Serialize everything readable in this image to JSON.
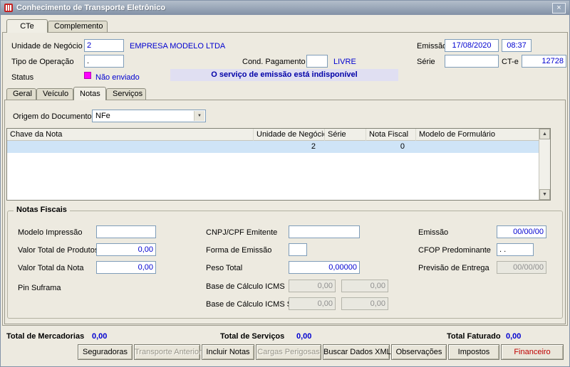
{
  "window": {
    "title": "Conhecimento de Transporte Eletrônico"
  },
  "icons": {
    "close": "×",
    "dropdown_arrow": "▼",
    "scroll_up": "▲",
    "scroll_down": "▼"
  },
  "main_tabs": {
    "cte": "CTe",
    "complemento": "Complemento"
  },
  "header": {
    "unidade_negocio": {
      "label": "Unidade de Negócio",
      "value": "2",
      "empresa": "EMPRESA MODELO LTDA"
    },
    "emissao": {
      "label": "Emissão",
      "date": "17/08/2020",
      "time": "08:37"
    },
    "tipo_operacao": {
      "label": "Tipo de Operação",
      "value": "."
    },
    "cond_pagamento": {
      "label": "Cond. Pagamento",
      "value": "",
      "descricao": "LIVRE"
    },
    "serie": {
      "label": "Série",
      "value": ""
    },
    "cte": {
      "label": "CT-e",
      "value": "12728"
    },
    "status": {
      "label": "Status",
      "value": "Não enviado"
    },
    "banner": "O serviço de emissão está indisponível"
  },
  "sub_tabs": {
    "geral": "Geral",
    "veiculo": "Veículo",
    "notas": "Notas",
    "servicos": "Serviços"
  },
  "notas": {
    "origem": {
      "label": "Origem do Documento",
      "value": "NFe"
    },
    "table": {
      "columns": [
        "Chave da Nota",
        "Unidade de Negócio",
        "Série",
        "Nota Fiscal",
        "Modelo de Formulário"
      ],
      "rows": [
        {
          "chave": "",
          "unidade_negocio": "2",
          "serie": "",
          "nota_fiscal": "0",
          "modelo_formulario": ""
        }
      ]
    },
    "grupo": {
      "titulo": "Notas Fiscais",
      "modelo_impressao": {
        "label": "Modelo Impressão",
        "value": ""
      },
      "valor_total_produtos": {
        "label": "Valor Total de Produtos",
        "value": "0,00"
      },
      "valor_total_nota": {
        "label": "Valor Total da Nota",
        "value": "0,00"
      },
      "pin_suframa": {
        "label": "Pin Suframa"
      },
      "cnpj_cpf_emitente": {
        "label": "CNPJ/CPF Emitente",
        "value": ""
      },
      "forma_emissao": {
        "label": "Forma de Emissão",
        "value": ""
      },
      "peso_total": {
        "label": "Peso Total",
        "value": "0,00000"
      },
      "base_calculo_icms": {
        "label": "Base de Cálculo ICMS",
        "value1": "0,00",
        "value2": "0,00"
      },
      "base_calculo_icms_st": {
        "label": "Base de Cálculo ICMS ST",
        "value1": "0,00",
        "value2": "0,00"
      },
      "emissao": {
        "label": "Emissão",
        "value": "00/00/00"
      },
      "cfop_predominante": {
        "label": "CFOP Predominante",
        "value": ". ."
      },
      "previsao_entrega": {
        "label": "Previsão de Entrega",
        "value": "00/00/00"
      }
    }
  },
  "totais": {
    "mercadorias": {
      "label": "Total de Mercadorias",
      "value": "0,00"
    },
    "servicos": {
      "label": "Total de Serviços",
      "value": "0,00"
    },
    "faturado": {
      "label": "Total Faturado",
      "value": "0,00"
    }
  },
  "buttons": {
    "seguradoras": "Seguradoras",
    "transporte_anterior": "Transporte Anterior",
    "incluir_notas": "Incluir Notas",
    "cargas_perigosas": "Cargas Perigosas",
    "buscar_dados_xml": "Buscar Dados XML",
    "observacoes": "Observações",
    "impostos": "Impostos",
    "financeiro": "Financeiro"
  },
  "colors": {
    "value_blue": "#0000D0",
    "status_magenta": "#FF00FF",
    "banner_bg": "#E0DFF2",
    "banner_text": "#0000A8",
    "selected_row": "#CFE4F7",
    "financeiro_red": "#C00000"
  }
}
